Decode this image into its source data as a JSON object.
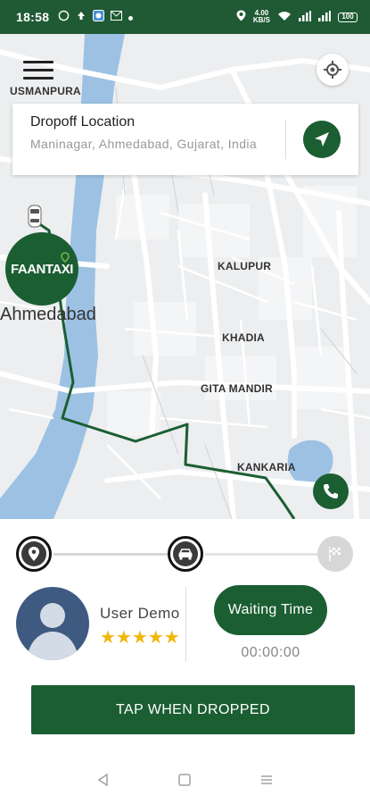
{
  "status_bar": {
    "time": "18:58",
    "network_speed": "4.00",
    "network_unit": "KB/S",
    "battery": "100",
    "icons": [
      "whatsapp-icon",
      "upload-icon",
      "app-icon",
      "gmail-icon",
      "dot-icon",
      "location-icon",
      "data-speed",
      "wifi-icon",
      "signal-icon",
      "signal-icon",
      "battery-icon"
    ]
  },
  "map": {
    "labels": {
      "usmanpura": "USMANPURA",
      "kalupur": "KALUPUR",
      "khadia": "KHADIA",
      "gita_mandir": "GITA MANDIR",
      "kankaria": "KANKARIA",
      "city": "Ahmedabad"
    }
  },
  "dropoff": {
    "title": "Dropoff Location",
    "address": "Maninagar, Ahmedabad, Gujarat, India"
  },
  "brand": {
    "logo_text": "FAANTAXI",
    "primary_color": "#1b5e32"
  },
  "progress": {
    "steps": [
      "pickup-pin",
      "taxi",
      "finish-flag"
    ],
    "current_step": 2
  },
  "rider": {
    "name": "User Demo",
    "stars": "★★★★★",
    "rating": 5
  },
  "waiting": {
    "label": "Waiting Time",
    "value": "00:00:00"
  },
  "action": {
    "label": "TAP WHEN DROPPED"
  }
}
